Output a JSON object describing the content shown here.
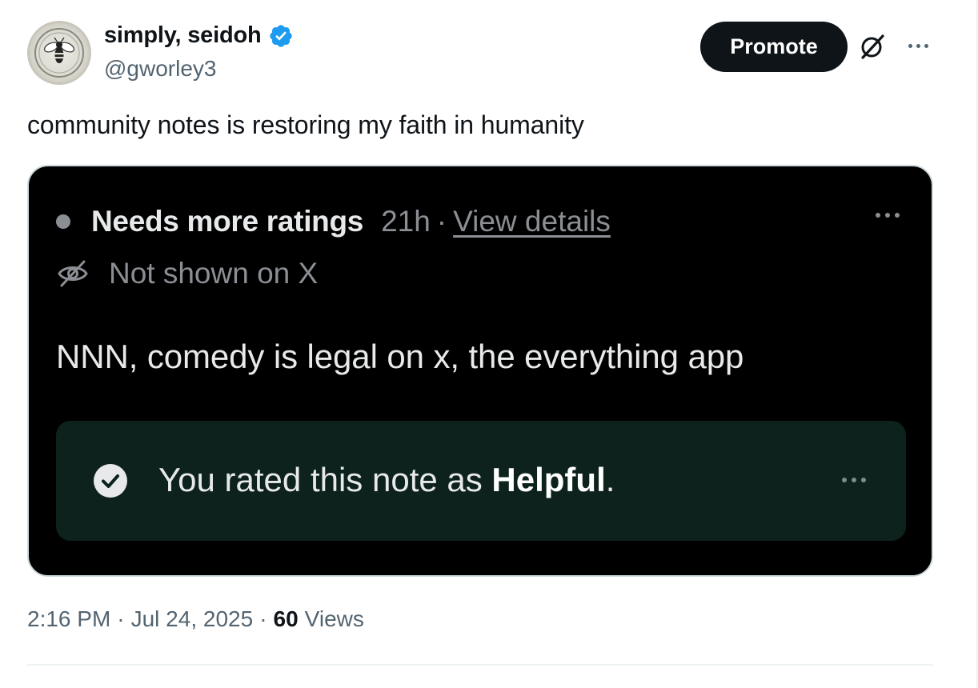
{
  "author": {
    "display_name": "simply, seidoh",
    "handle": "@gworley3",
    "avatar_icon": "bee-emblem-avatar",
    "verified_icon": "verified-badge-icon",
    "verified_color": "#1d9bf0"
  },
  "header_actions": {
    "promote_label": "Promote",
    "grok_icon": "grok-icon",
    "more_icon": "more-icon"
  },
  "tweet": {
    "text": "community notes is restoring my faith in humanity"
  },
  "note": {
    "status_label": "Needs more ratings",
    "age": "21h",
    "separator": "·",
    "view_details_label": "View details",
    "visibility_label": "Not shown on X",
    "body": "NNN, comedy is legal on x, the everything app",
    "rating_prefix": "You rated this note as ",
    "rating_value": "Helpful",
    "rating_suffix": ".",
    "rated_box_color": "#0d221c"
  },
  "meta": {
    "time": "2:16 PM",
    "separator": "·",
    "date": "Jul 24, 2025",
    "views_count": "60",
    "views_label": "Views"
  }
}
